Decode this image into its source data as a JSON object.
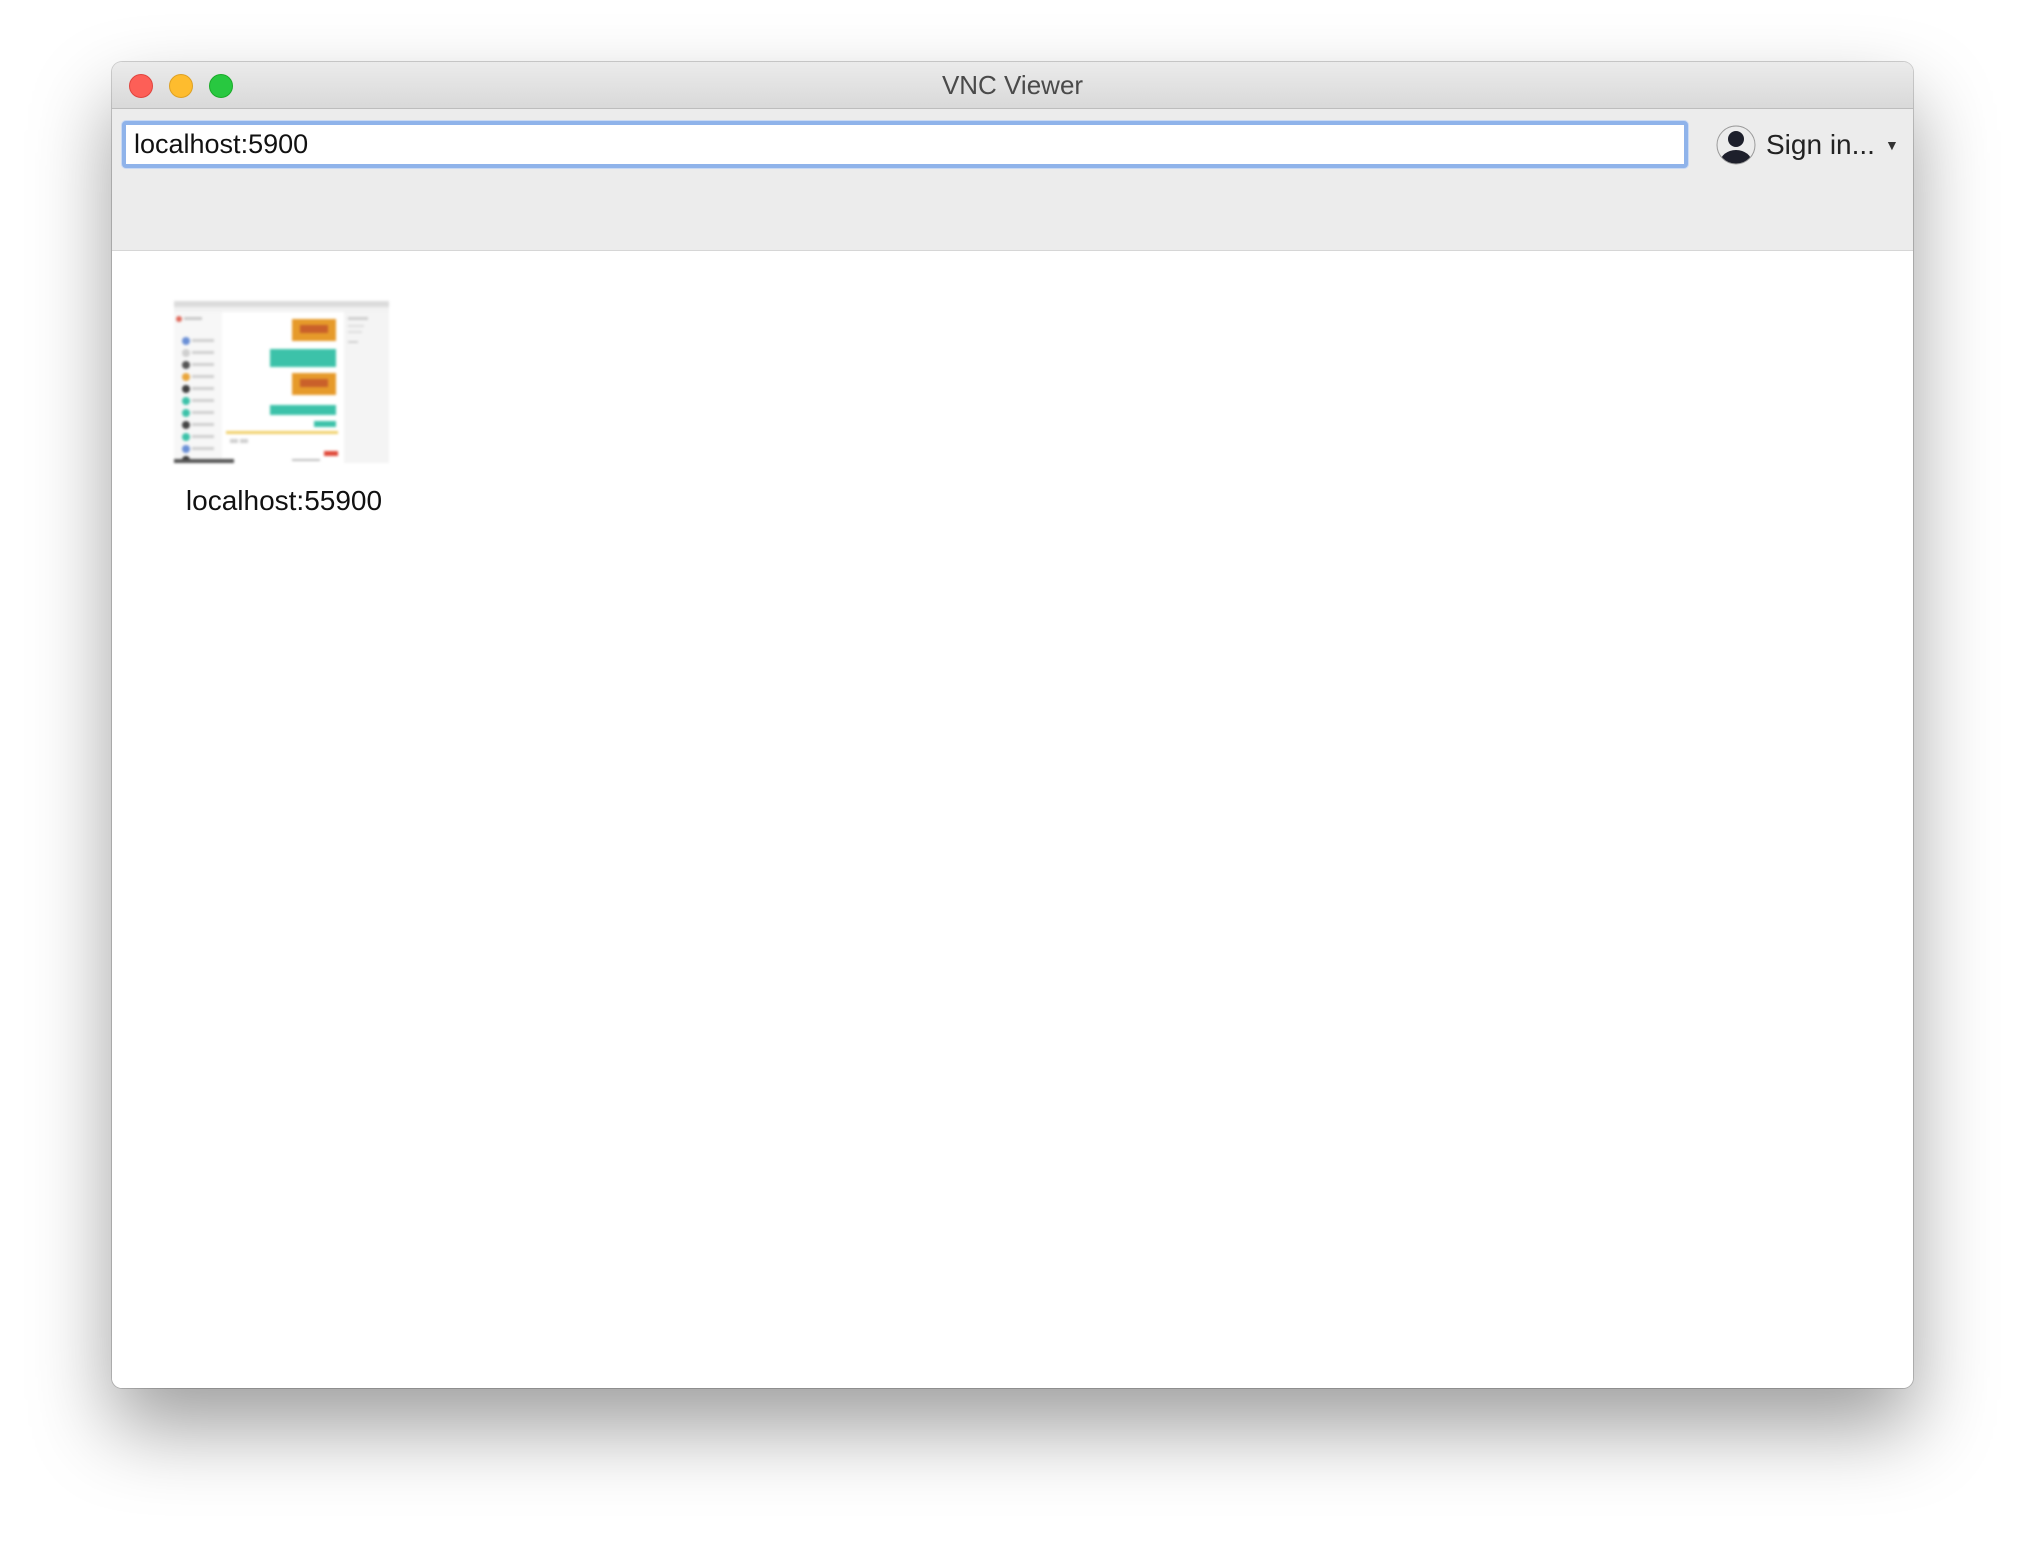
{
  "window": {
    "title": "VNC Viewer"
  },
  "toolbar": {
    "address_value": "localhost:5900",
    "signin_label": "Sign in...",
    "signin_icon": "user-avatar-icon",
    "dropdown_icon": "chevron-down-icon"
  },
  "address_book": {
    "items": [
      {
        "label": "localhost:55900",
        "thumbnail": "desktop-preview"
      }
    ]
  },
  "colors": {
    "close": "#fd5f57",
    "minimize": "#febc2e",
    "maximize": "#28c840",
    "focus_ring": "#8fb3ea",
    "thumbnail_accent_teal": "#3cc2a9",
    "thumbnail_accent_orange": "#e69a2a"
  }
}
